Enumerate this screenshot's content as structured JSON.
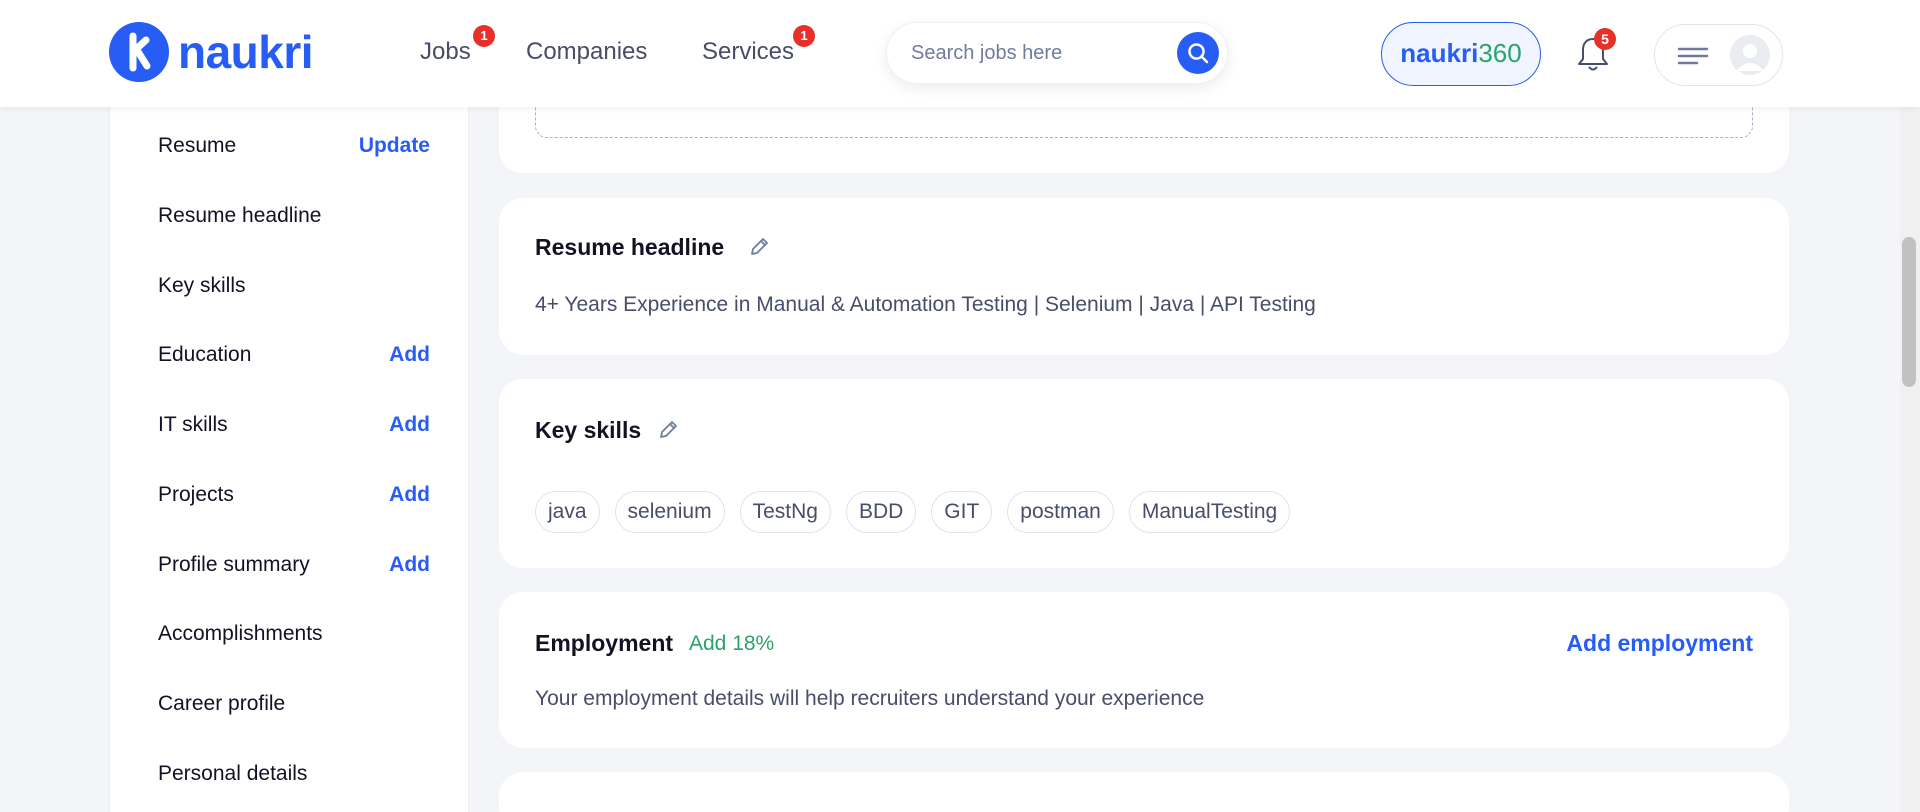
{
  "header": {
    "logo_text": "naukri",
    "nav": [
      {
        "label": "Jobs",
        "badge": "1"
      },
      {
        "label": "Companies",
        "badge": ""
      },
      {
        "label": "Services",
        "badge": "1"
      }
    ],
    "search_placeholder": "Search jobs here",
    "naukri360": {
      "part1": "naukri",
      "part2": "360"
    },
    "notification_count": "5"
  },
  "sidebar": {
    "items": [
      {
        "label": "Resume",
        "action": "Update"
      },
      {
        "label": "Resume headline",
        "action": ""
      },
      {
        "label": "Key skills",
        "action": ""
      },
      {
        "label": "Education",
        "action": "Add"
      },
      {
        "label": "IT skills",
        "action": "Add"
      },
      {
        "label": "Projects",
        "action": "Add"
      },
      {
        "label": "Profile summary",
        "action": "Add"
      },
      {
        "label": "Accomplishments",
        "action": ""
      },
      {
        "label": "Career profile",
        "action": ""
      },
      {
        "label": "Personal details",
        "action": ""
      }
    ]
  },
  "resume_headline": {
    "title": "Resume headline",
    "text": "4+ Years Experience in Manual & Automation Testing | Selenium | Java | API Testing"
  },
  "key_skills": {
    "title": "Key skills",
    "skills": [
      "java",
      "selenium",
      "TestNg",
      "BDD",
      "GIT",
      "postman",
      "ManualTesting"
    ]
  },
  "employment": {
    "title": "Employment",
    "add_percent": "Add 18%",
    "action": "Add employment",
    "text": "Your employment details will help recruiters understand your experience"
  },
  "colors": {
    "brand_blue": "#275df5",
    "green": "#2ba36a",
    "badge_red": "#e4322b",
    "background": "#f4f5f8"
  }
}
